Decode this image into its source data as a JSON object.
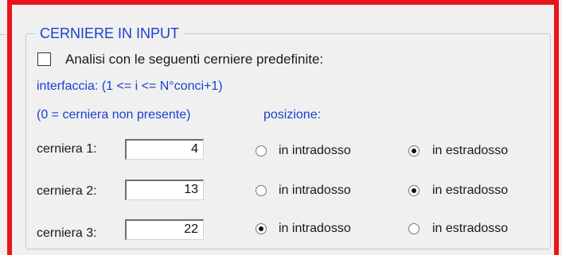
{
  "group": {
    "title": "CERNIERE IN INPUT"
  },
  "checkbox": {
    "label": "Analisi con le seguenti cerniere predefinite:",
    "checked": false
  },
  "info": {
    "line1": "interfaccia: (1 <= i <= N°conci+1)",
    "line2": "(0 = cerniera non presente)",
    "position_label": "posizione:"
  },
  "hinges": [
    {
      "label": "cerniera 1:",
      "value": "4",
      "intrados_label": "in intradosso",
      "extrados_label": "in estradosso",
      "selected": "estradosso"
    },
    {
      "label": "cerniera 2:",
      "value": "13",
      "intrados_label": "in intradosso",
      "extrados_label": "in estradosso",
      "selected": "estradosso"
    },
    {
      "label": "cerniera 3:",
      "value": "22",
      "intrados_label": "in intradosso",
      "extrados_label": "in estradosso",
      "selected": "intradosso"
    }
  ],
  "colors": {
    "accent_red": "#e8141c",
    "label_blue": "#1a3fd0",
    "background": "#f0f0f0"
  }
}
